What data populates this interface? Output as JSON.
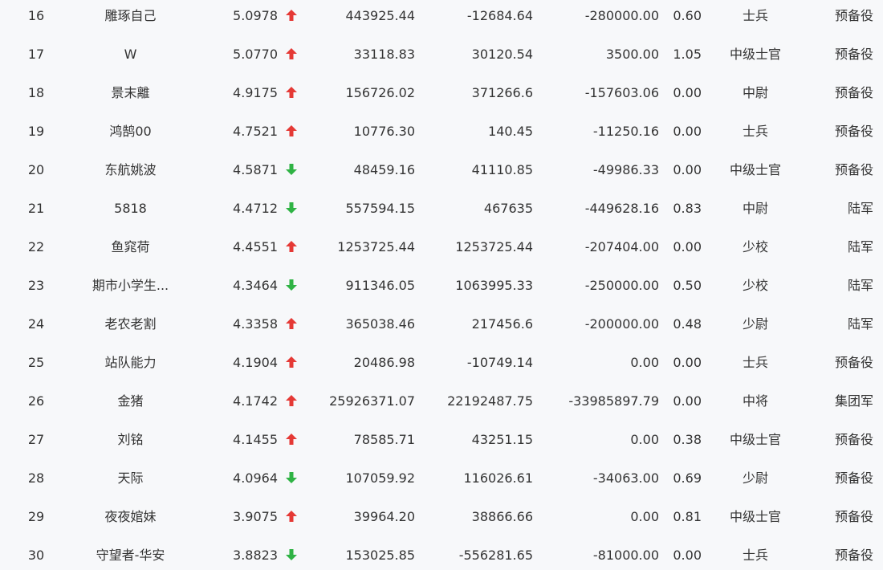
{
  "colors": {
    "up": "#e53935",
    "down": "#2fb344",
    "text": "#333333",
    "background": "#f7f8fa"
  },
  "rows": [
    {
      "rank": "16",
      "name": "雕琢自己",
      "score": "5.0978",
      "trend": "up",
      "trend_icon": "arrow-up-icon",
      "v1": "443925.44",
      "v2": "-12684.64",
      "v3": "-280000.00",
      "v4": "0.60",
      "military_rank": "士兵",
      "unit": "预备役"
    },
    {
      "rank": "17",
      "name": "W",
      "score": "5.0770",
      "trend": "up",
      "trend_icon": "arrow-up-icon",
      "v1": "33118.83",
      "v2": "30120.54",
      "v3": "3500.00",
      "v4": "1.05",
      "military_rank": "中级士官",
      "unit": "预备役"
    },
    {
      "rank": "18",
      "name": "景末離",
      "score": "4.9175",
      "trend": "up",
      "trend_icon": "arrow-up-icon",
      "v1": "156726.02",
      "v2": "371266.6",
      "v3": "-157603.06",
      "v4": "0.00",
      "military_rank": "中尉",
      "unit": "预备役"
    },
    {
      "rank": "19",
      "name": "鸿鹄00",
      "score": "4.7521",
      "trend": "up",
      "trend_icon": "arrow-up-icon",
      "v1": "10776.30",
      "v2": "140.45",
      "v3": "-11250.16",
      "v4": "0.00",
      "military_rank": "士兵",
      "unit": "预备役"
    },
    {
      "rank": "20",
      "name": "东航姚波",
      "score": "4.5871",
      "trend": "down",
      "trend_icon": "arrow-down-icon",
      "v1": "48459.16",
      "v2": "41110.85",
      "v3": "-49986.33",
      "v4": "0.00",
      "military_rank": "中级士官",
      "unit": "预备役"
    },
    {
      "rank": "21",
      "name": "5818",
      "score": "4.4712",
      "trend": "down",
      "trend_icon": "arrow-down-icon",
      "v1": "557594.15",
      "v2": "467635",
      "v3": "-449628.16",
      "v4": "0.83",
      "military_rank": "中尉",
      "unit": "陆军"
    },
    {
      "rank": "22",
      "name": "鱼窕荷",
      "score": "4.4551",
      "trend": "up",
      "trend_icon": "arrow-up-icon",
      "v1": "1253725.44",
      "v2": "1253725.44",
      "v3": "-207404.00",
      "v4": "0.00",
      "military_rank": "少校",
      "unit": "陆军"
    },
    {
      "rank": "23",
      "name": "期市小学生...",
      "score": "4.3464",
      "trend": "down",
      "trend_icon": "arrow-down-icon",
      "v1": "911346.05",
      "v2": "1063995.33",
      "v3": "-250000.00",
      "v4": "0.50",
      "military_rank": "少校",
      "unit": "陆军"
    },
    {
      "rank": "24",
      "name": "老农老割",
      "score": "4.3358",
      "trend": "up",
      "trend_icon": "arrow-up-icon",
      "v1": "365038.46",
      "v2": "217456.6",
      "v3": "-200000.00",
      "v4": "0.48",
      "military_rank": "少尉",
      "unit": "陆军"
    },
    {
      "rank": "25",
      "name": "站队能力",
      "score": "4.1904",
      "trend": "up",
      "trend_icon": "arrow-up-icon",
      "v1": "20486.98",
      "v2": "-10749.14",
      "v3": "0.00",
      "v4": "0.00",
      "military_rank": "士兵",
      "unit": "预备役"
    },
    {
      "rank": "26",
      "name": "金猪",
      "score": "4.1742",
      "trend": "up",
      "trend_icon": "arrow-up-icon",
      "v1": "25926371.07",
      "v2": "22192487.75",
      "v3": "-33985897.79",
      "v4": "0.00",
      "military_rank": "中将",
      "unit": "集团军"
    },
    {
      "rank": "27",
      "name": "刘铭",
      "score": "4.1455",
      "trend": "up",
      "trend_icon": "arrow-up-icon",
      "v1": "78585.71",
      "v2": "43251.15",
      "v3": "0.00",
      "v4": "0.38",
      "military_rank": "中级士官",
      "unit": "预备役"
    },
    {
      "rank": "28",
      "name": "天际",
      "score": "4.0964",
      "trend": "down",
      "trend_icon": "arrow-down-icon",
      "v1": "107059.92",
      "v2": "116026.61",
      "v3": "-34063.00",
      "v4": "0.69",
      "military_rank": "少尉",
      "unit": "预备役"
    },
    {
      "rank": "29",
      "name": "夜夜婠妹",
      "score": "3.9075",
      "trend": "up",
      "trend_icon": "arrow-up-icon",
      "v1": "39964.20",
      "v2": "38866.66",
      "v3": "0.00",
      "v4": "0.81",
      "military_rank": "中级士官",
      "unit": "预备役"
    },
    {
      "rank": "30",
      "name": "守望者-华安",
      "score": "3.8823",
      "trend": "down",
      "trend_icon": "arrow-down-icon",
      "v1": "153025.85",
      "v2": "-556281.65",
      "v3": "-81000.00",
      "v4": "0.00",
      "military_rank": "士兵",
      "unit": "预备役"
    }
  ]
}
